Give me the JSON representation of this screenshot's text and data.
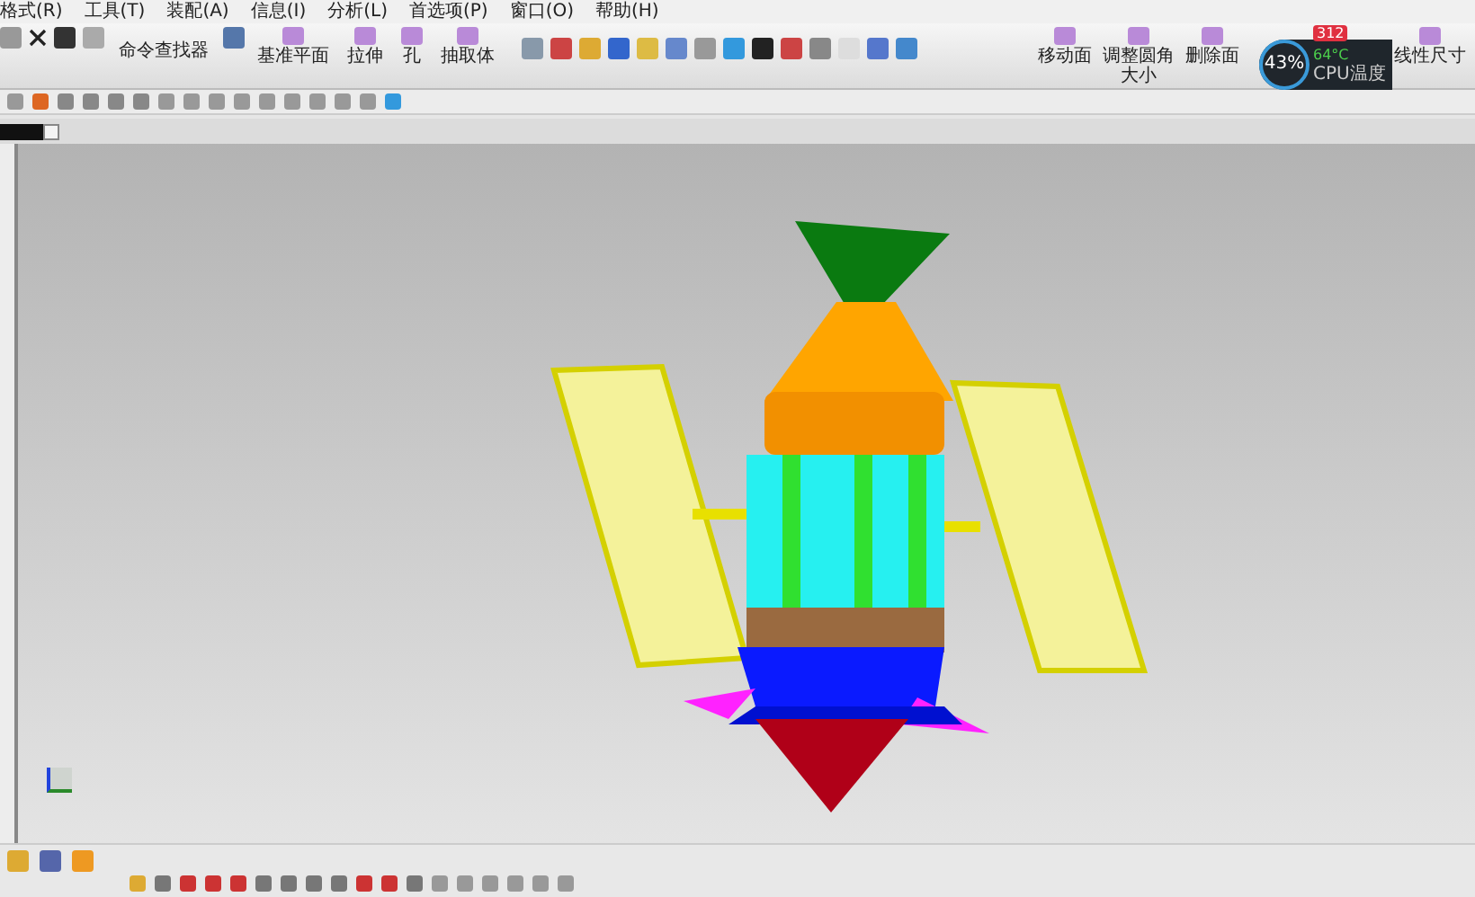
{
  "menu_bar": [
    "格式(R)",
    "工具(T)",
    "装配(A)",
    "信息(I)",
    "分析(L)",
    "首选项(P)",
    "窗口(O)",
    "帮助(H)"
  ],
  "toolbar": [
    {
      "kind": "inline",
      "label": "命令查找器"
    },
    {
      "kind": "stacked",
      "label": "基准平面"
    },
    {
      "kind": "stacked",
      "label": "拉伸"
    },
    {
      "kind": "stacked",
      "label": "孔"
    },
    {
      "kind": "stacked",
      "label": "抽取体"
    },
    {
      "kind": "stacked",
      "label": "移动面"
    },
    {
      "kind": "stacked",
      "label": "调整圆角大小"
    },
    {
      "kind": "stacked",
      "label": "删除面"
    },
    {
      "kind": "stacked",
      "label": "线性尺寸"
    }
  ],
  "cpu_widget": {
    "percent": "43%",
    "temperature": "64°C",
    "label": "CPU温度",
    "badge": "312"
  }
}
